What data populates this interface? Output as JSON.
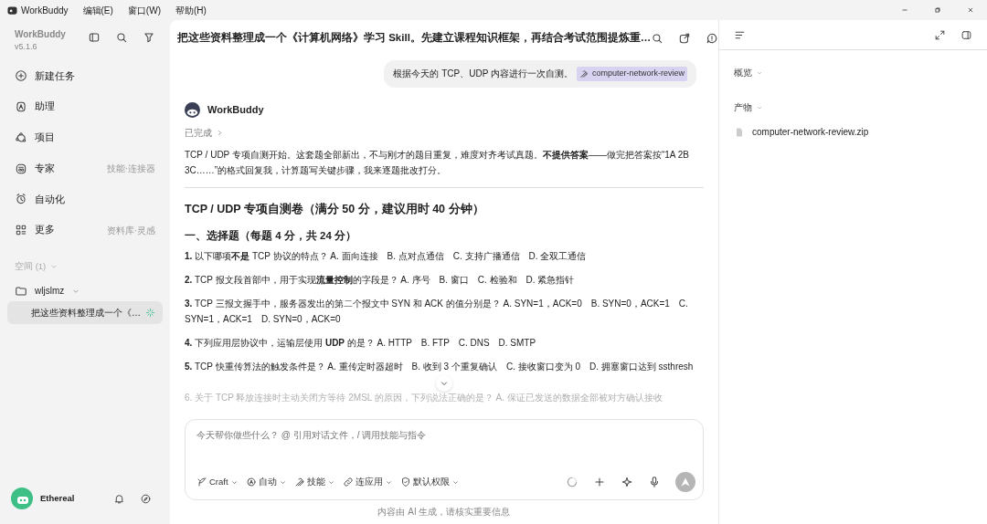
{
  "app": {
    "name": "WorkBuddy",
    "menus": [
      "编辑(E)",
      "窗口(W)",
      "帮助(H)"
    ]
  },
  "sidebar": {
    "brand": "WorkBuddy",
    "version": "v5.1.6",
    "nav": [
      {
        "label": "新建任务"
      },
      {
        "label": "助理"
      },
      {
        "label": "项目"
      },
      {
        "label": "专家",
        "hint": "技能·连接器"
      },
      {
        "label": "自动化"
      },
      {
        "label": "更多",
        "hint": "资料库·灵感"
      }
    ],
    "spaces": {
      "label": "空间 (1)",
      "expanded": true,
      "folders": [
        {
          "name": "wljslmz",
          "expanded": true,
          "children": [
            {
              "title": "把这些资料整理成一个《…",
              "selected": true,
              "running": true
            }
          ]
        }
      ]
    },
    "user": {
      "name": "Ethereal"
    }
  },
  "main": {
    "title": "把这些资料整理成一个《计算机网络》学习 Skill。先建立课程知识框架，再结合考试范围提炼重…",
    "user_message": {
      "text": "根据今天的 TCP、UDP 内容进行一次自测。",
      "skill_tag": "computer-network-review"
    },
    "reply": {
      "author": "WorkBuddy",
      "status": "已完成",
      "intro": "TCP / UDP 专项自测开始。这套题全部新出，不与刚才的题目重复，难度对齐考试真题。**不提供答案**——做完把答案按“1A 2B 3C……”的格式回复我，计算题写关键步骤，我来逐题批改打分。",
      "heading": "TCP / UDP 专项自测卷（满分 50 分，建议用时 40 分钟）",
      "section": "一、选择题（每题 4 分，共 24 分）",
      "questions": [
        {
          "text": "**1.** 以下哪项**不是** TCP 协议的特点？ A. 面向连接　B. 点对点通信　C. 支持广播通信　D. 全双工通信",
          "faded": false
        },
        {
          "text": "**2.** TCP 报文段首部中，用于实现**流量控制**的字段是？ A. 序号　B. 窗口　C. 检验和　D. 紧急指针",
          "faded": false
        },
        {
          "text": "**3.** TCP 三报文握手中，服务器发出的第二个报文中 SYN 和 ACK 的值分别是？ A. SYN=1，ACK=0　B. SYN=0，ACK=1　C. SYN=1，ACK=1　D. SYN=0，ACK=0",
          "faded": false
        },
        {
          "text": "**4.** 下列应用层协议中，运输层使用 **UDP** 的是？ A. HTTP　B. FTP　C. DNS　D. SMTP",
          "faded": false
        },
        {
          "text": "**5.** TCP 快重传算法的触发条件是？ A. 重传定时器超时　B. 收到 3 个重复确认　C. 接收窗口变为 0　D. 拥塞窗口达到 ssthresh",
          "faded": false
        },
        {
          "text": "6. 关于 TCP 释放连接时主动关闭方等待 2MSL 的原因，下列说法正确的是？ A. 保证已发送的数据全部被对方确认接收",
          "faded": true
        }
      ]
    },
    "composer": {
      "placeholder": "今天帮你做些什么？ @ 引用对话文件，/ 调用技能与指令",
      "tools": [
        {
          "label": "Craft"
        },
        {
          "label": "自动"
        },
        {
          "label": "技能"
        },
        {
          "label": "连应用"
        },
        {
          "label": "默认权限"
        }
      ],
      "send_disabled": true
    },
    "footer": "内容由 AI 生成，请核实重要信息"
  },
  "panel": {
    "sections": [
      {
        "title": "概览"
      },
      {
        "title": "产物",
        "files": [
          "computer-network-review.zip"
        ]
      }
    ]
  }
}
